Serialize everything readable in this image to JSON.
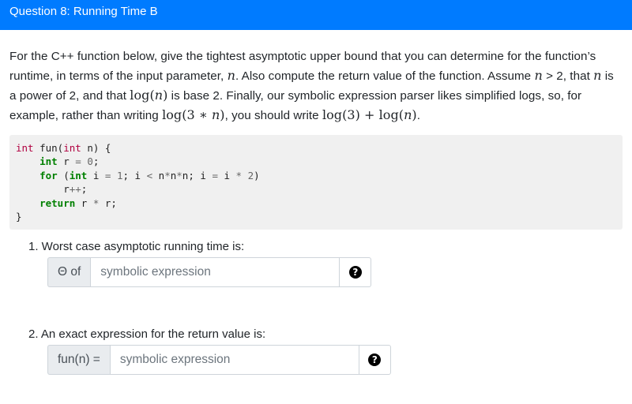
{
  "header": {
    "title": "Question 8: Running Time B"
  },
  "prompt": {
    "t1": "For the C++ function below, give the tightest asymptotic upper bound that you can determine for the function’s runtime, in terms of the input parameter, ",
    "n": "n",
    "t2": ". Also compute the return value of the function. Assume ",
    "t3": " > 2, that ",
    "t4": " is a power of 2, and that ",
    "t5": " is base 2. Finally, our symbolic expression parser likes simplified logs, so, for example, rather than writing ",
    "t6": ", you should write ",
    "t7": ".",
    "log_n": "log(𝑛)",
    "log_3n": "log(3 ∗ 𝑛)",
    "log3_plus_logn": "log(3) + log(𝑛)"
  },
  "code": {
    "lines": [
      "int fun(int n) {",
      "    int r = 0;",
      "    for (int i = 1; i < n*n*n; i = i * 2)",
      "        r++;",
      "    return r * r;",
      "}"
    ]
  },
  "parts": [
    {
      "label": "1. Worst case asymptotic running time is:",
      "prefix": "Θ of",
      "placeholder": "symbolic expression",
      "value": ""
    },
    {
      "label": "2. An exact expression for the return value is:",
      "prefix": "fun(n) =",
      "placeholder": "symbolic expression",
      "value": ""
    }
  ],
  "icons": {
    "help": "question-circle-icon"
  },
  "colors": {
    "header": "#007bff",
    "code_bg": "#f0f0f0"
  }
}
